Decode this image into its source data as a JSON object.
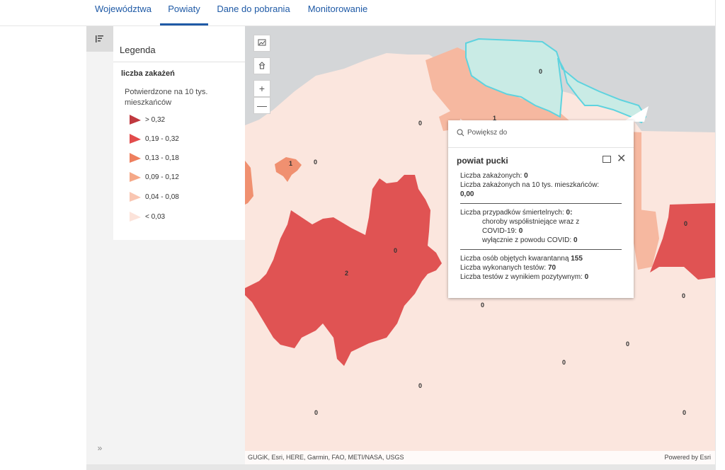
{
  "nav": {
    "tabs": [
      {
        "label": "Województwa",
        "active": false
      },
      {
        "label": "Powiaty",
        "active": true
      },
      {
        "label": "Dane do pobrania",
        "active": false
      },
      {
        "label": "Monitorowanie",
        "active": false
      }
    ]
  },
  "legend": {
    "title": "Legenda",
    "layer_title": "liczba zakażeń",
    "field_title": "Potwierdzone na 10 tys. mieszkańców",
    "classes": [
      {
        "label": "> 0,32",
        "color": "#c0393f"
      },
      {
        "label": "0,19 - 0,32",
        "color": "#e24c4c"
      },
      {
        "label": "0,13 - 0,18",
        "color": "#ee7f5e"
      },
      {
        "label": "0,09 - 0,12",
        "color": "#f5a887"
      },
      {
        "label": "0,04 - 0,08",
        "color": "#f9c6b2"
      },
      {
        "label": "< 0,03",
        "color": "#fce3da"
      }
    ],
    "expand_icon": "»"
  },
  "map": {
    "controls": {
      "basemap_icon": "basemap-gallery-icon",
      "home_icon": "home-icon",
      "zoom_in": "+",
      "zoom_out": "—"
    },
    "labels": {
      "label_a": "0",
      "label_b": "1",
      "label_c": "1",
      "label_d": "0",
      "label_e": "0",
      "label_f": "2",
      "label_g": "0",
      "label_h": "0",
      "label_i": "0",
      "label_j": "0",
      "label_k": "0",
      "label_l": "0",
      "label_m": "0",
      "label_n": "0",
      "label_o": "0"
    },
    "attribution": "GUGiK, Esri, HERE, Garmin, FAO, METI/NASA, USGS",
    "powered_by": "Powered by Esri"
  },
  "popup": {
    "zoom_label": "Powiększ do",
    "title": "powiat pucki",
    "line1_label": "Liczba zakażonych:",
    "line1_value": "0",
    "line2_label": "Liczba zakażonych na 10 tys. mieszkańców:",
    "line2_value": "0,00",
    "line3_label": "Liczba przypadków śmiertelnych:",
    "line3_value": "0:",
    "line4": "choroby współistniejące wraz z",
    "line5_label": "COVID-19:",
    "line5_value": "0",
    "line6_label": "wyłącznie z powodu COVID:",
    "line6_value": "0",
    "line7_label": "Liczba osób objętych kwarantanną",
    "line7_value": "155",
    "line8_label": "Liczba wykonanych testów:",
    "line8_value": "70",
    "line9_label": "Liczba testów z wynikiem pozytywnym:",
    "line9_value": "0"
  }
}
